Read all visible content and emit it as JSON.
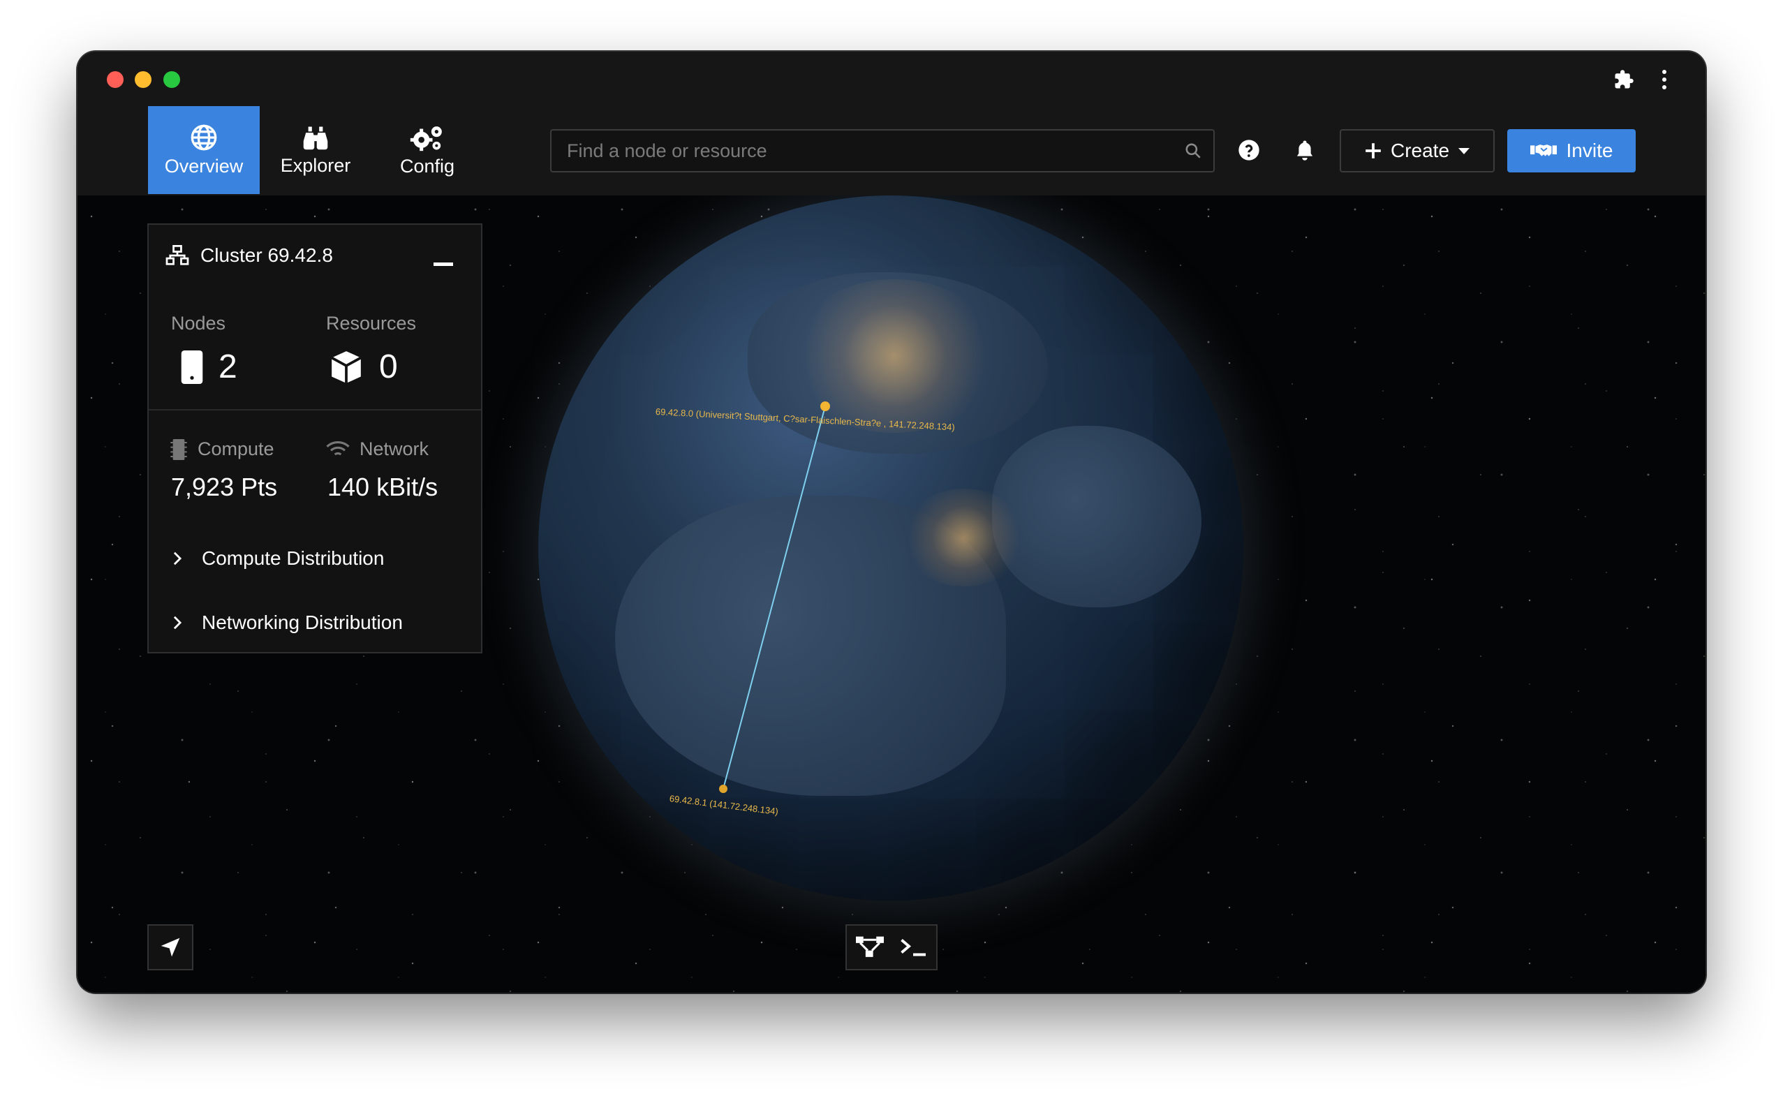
{
  "window": {
    "titlebar_icons": [
      "puzzle-icon",
      "more-vertical-icon"
    ]
  },
  "nav": {
    "tabs": [
      {
        "label": "Overview",
        "icon": "globe-icon",
        "active": true
      },
      {
        "label": "Explorer",
        "icon": "binoculars-icon",
        "active": false
      },
      {
        "label": "Config",
        "icon": "gears-icon",
        "active": false
      }
    ],
    "search_placeholder": "Find a node or resource",
    "create_label": "Create",
    "invite_label": "Invite",
    "accent_color": "#3a84e0"
  },
  "cluster": {
    "title": "Cluster 69.42.8",
    "nodes_label": "Nodes",
    "nodes_value": "2",
    "resources_label": "Resources",
    "resources_value": "0",
    "compute_label": "Compute",
    "compute_value": "7,923 Pts",
    "network_label": "Network",
    "network_value": "140 kBit/s",
    "expanders": [
      "Compute Distribution",
      "Networking Distribution"
    ]
  },
  "map": {
    "node_a_label": "69.42.8.0 (Universit?t Stuttgart, C?sar-Flaischlen-Stra?e , 141.72.248.134)",
    "node_b_label": "69.42.8.1 (141.72.248.134)",
    "link_color": "#7fd0ee",
    "node_color": "#f2b632"
  }
}
